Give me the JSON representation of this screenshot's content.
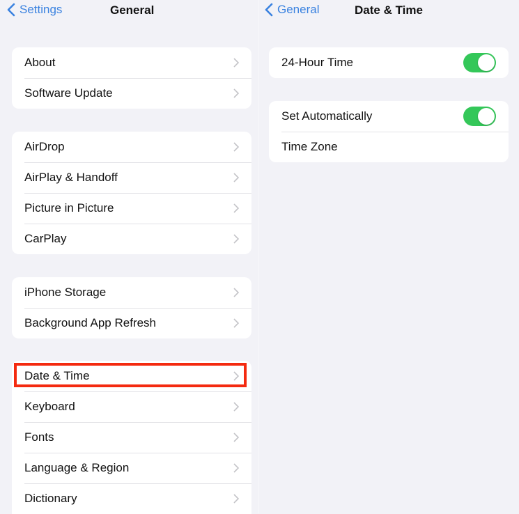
{
  "left_pane": {
    "nav": {
      "back_label": "Settings",
      "title": "General"
    },
    "groups": [
      {
        "items": [
          {
            "label": "About"
          },
          {
            "label": "Software Update"
          }
        ]
      },
      {
        "items": [
          {
            "label": "AirDrop"
          },
          {
            "label": "AirPlay & Handoff"
          },
          {
            "label": "Picture in Picture"
          },
          {
            "label": "CarPlay"
          }
        ]
      },
      {
        "items": [
          {
            "label": "iPhone Storage"
          },
          {
            "label": "Background App Refresh"
          }
        ]
      },
      {
        "items": [
          {
            "label": "Date & Time",
            "highlighted": true
          },
          {
            "label": "Keyboard"
          },
          {
            "label": "Fonts"
          },
          {
            "label": "Language & Region"
          },
          {
            "label": "Dictionary"
          }
        ]
      }
    ]
  },
  "right_pane": {
    "nav": {
      "back_label": "General",
      "title": "Date & Time"
    },
    "groups": [
      {
        "items": [
          {
            "label": "24-Hour Time",
            "toggle": true,
            "on": true
          }
        ]
      },
      {
        "items": [
          {
            "label": "Set Automatically",
            "toggle": true,
            "on": true
          },
          {
            "label": "Time Zone",
            "value": ""
          }
        ]
      }
    ]
  },
  "colors": {
    "accent": "#3a82e0",
    "toggle_on": "#34c759",
    "highlight": "#f42a10",
    "background": "#f2f2f7"
  }
}
